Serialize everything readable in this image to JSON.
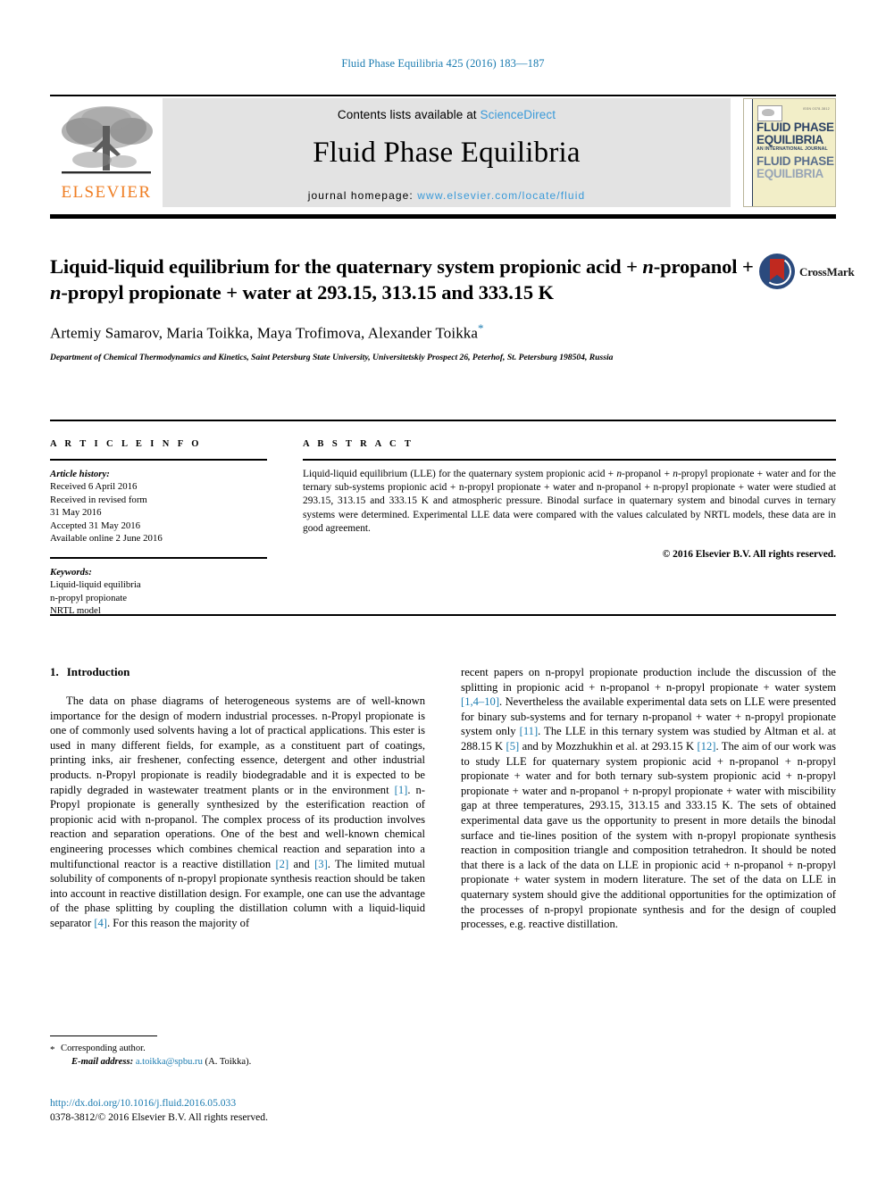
{
  "running_head": "Fluid Phase Equilibria 425 (2016) 183—187",
  "banner": {
    "contents_prefix": "Contents lists available at ",
    "sciencedirect": "ScienceDirect",
    "journal_name": "Fluid Phase Equilibria",
    "homepage_prefix": "journal homepage: ",
    "homepage_url": "www.elsevier.com/locate/fluid",
    "publisher_name": "ELSEVIER",
    "cover": {
      "title_line1": "FLUID PHASE",
      "title_line2": "EQUILIBRIA",
      "subtitle": "AN INTERNATIONAL JOURNAL",
      "title_line3": "FLUID PHASE",
      "title_line4": "EQUILIBRIA",
      "top_code": "ISSN 0378-3812"
    }
  },
  "crossmark": {
    "label": "CrossMark"
  },
  "article": {
    "title_part1": "Liquid-liquid equilibrium for the quaternary system propionic acid + ",
    "title_italic1": "n",
    "title_part2": "-propanol + ",
    "title_italic2": "n",
    "title_part3": "-propyl propionate + water at 293.15, 313.15 and 333.15 K",
    "authors": "Artemiy Samarov, Maria Toikka, Maya Trofimova, Alexander Toikka",
    "corresponding_marker": "*",
    "affiliation": "Department of Chemical Thermodynamics and Kinetics, Saint Petersburg State University, Universitetskiy Prospect 26, Peterhof, St. Petersburg 198504, Russia"
  },
  "article_info": {
    "heading": "A R T I C L E   I N F O",
    "history_label": "Article history:",
    "history": [
      "Received 6 April 2016",
      "Received in revised form",
      "31 May 2016",
      "Accepted 31 May 2016",
      "Available online 2 June 2016"
    ],
    "keywords_label": "Keywords:",
    "keywords": [
      "Liquid-liquid equilibria",
      "n-propyl propionate",
      "NRTL model"
    ]
  },
  "abstract": {
    "heading": "A B S T R A C T",
    "text_p1": "Liquid-liquid equilibrium (LLE) for the quaternary system propionic acid + ",
    "text_i1": "n",
    "text_p2": "-propanol + ",
    "text_i2": "n",
    "text_p3": "-propyl propionate + water and for the ternary sub-systems propionic acid + n-propyl propionate + water and n-propanol + n-propyl propionate + water were studied at 293.15, 313.15 and 333.15 K and atmospheric pressure. Binodal surface in quaternary system and binodal curves in ternary systems were determined. Experimental LLE data were compared with the values calculated by NRTL models, these data are in good agreement.",
    "copyright": "© 2016 Elsevier B.V. All rights reserved."
  },
  "introduction": {
    "number": "1.",
    "title": "Introduction",
    "left_col": {
      "s1": "The data on phase diagrams of heterogeneous systems are of well-known importance for the design of modern industrial processes. n-Propyl propionate is one of commonly used solvents having a lot of practical applications. This ester is used in many different fields, for example, as a constituent part of coatings, printing inks, air freshener, confecting essence, detergent and other industrial products. n-Propyl propionate is readily biodegradable and it is expected to be rapidly degraded in wastewater treatment plants or in the environment ",
      "r1": "[1]",
      "s2": ". n-Propyl propionate is generally synthesized by the esterification reaction of propionic acid with n-propanol. The complex process of its production involves reaction and separation operations. One of the best and well-known chemical engineering processes which combines chemical reaction and separation into a multifunctional reactor is a reactive distillation ",
      "r2": "[2]",
      "s3": " and ",
      "r3": "[3]",
      "s4": ". The limited mutual solubility of components of n-propyl propionate synthesis reaction should be taken into account in reactive distillation design. For example, one can use the advantage of the phase splitting by coupling the distillation column with a liquid-liquid separator ",
      "r4": "[4]",
      "s5": ". For this reason the majority of"
    },
    "right_col": {
      "s1": "recent papers on n-propyl propionate production include the discussion of the splitting in propionic acid + n-propanol + n-propyl propionate + water system ",
      "r1": "[1,4–10]",
      "s2": ". Nevertheless the available experimental data sets on LLE were presented for binary sub-systems and for ternary n-propanol + water + n-propyl propionate system only ",
      "r2": "[11]",
      "s3": ". The LLE in this ternary system was studied by Altman et al. at 288.15 K ",
      "r3": "[5]",
      "s4": " and by Mozzhukhin et al. at 293.15 K ",
      "r4": "[12]",
      "s5": ". The aim of our work was to study LLE for quaternary system propionic acid + n-propanol + n-propyl propionate + water and for both ternary sub-system propionic acid + n-propyl propionate + water and n-propanol + n-propyl propionate + water with miscibility gap at three temperatures, 293.15, 313.15 and 333.15 K. The sets of obtained experimental data gave us the opportunity to present in more details the binodal surface and tie-lines position of the system with n-propyl propionate synthesis reaction in composition triangle and composition tetrahedron. It should be noted that there is a lack of the data on LLE in propionic acid + n-propanol + n-propyl propionate + water system in modern literature. The set of the data on LLE in quaternary system should give the additional opportunities for the optimization of the processes of n-propyl propionate synthesis and for the design of coupled processes, e.g. reactive distillation."
    }
  },
  "footnotes": {
    "star": "*",
    "corresponding": "Corresponding author.",
    "email_label": "E-mail address:",
    "email": "a.toikka@spbu.ru",
    "email_suffix": "(A. Toikka)."
  },
  "footer": {
    "doi": "http://dx.doi.org/10.1016/j.fluid.2016.05.033",
    "issn_line": "0378-3812/© 2016 Elsevier B.V. All rights reserved."
  },
  "colors": {
    "link": "#1a7bb0",
    "sciencedirect": "#3a9ad9",
    "elsevier_orange": "#ef7d22",
    "banner_bg": "#e3e3e3",
    "crossmark_blue": "#2b4a7d",
    "crossmark_red": "#c0291f"
  }
}
